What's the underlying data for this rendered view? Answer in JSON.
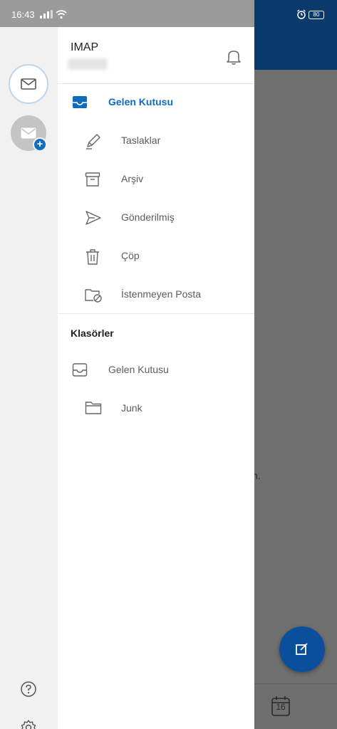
{
  "status_bar": {
    "time": "16:43",
    "battery": "80"
  },
  "account": {
    "title": "IMAP"
  },
  "folders": [
    {
      "label": "Gelen Kutusu",
      "icon": "inbox-icon",
      "active": true
    },
    {
      "label": "Taslaklar",
      "icon": "pencil-icon"
    },
    {
      "label": "Arşiv",
      "icon": "archive-icon"
    },
    {
      "label": "Gönderilmiş",
      "icon": "send-icon"
    },
    {
      "label": "Çöp",
      "icon": "trash-icon"
    },
    {
      "label": "İstenmeyen Posta",
      "icon": "junk-folder-icon"
    }
  ],
  "folders_section": {
    "title": "Klasörler",
    "items": [
      {
        "label": "Gelen Kutusu",
        "icon": "inbox-icon"
      },
      {
        "label": "Junk",
        "icon": "folder-icon"
      }
    ]
  },
  "background": {
    "partial_text": "n.",
    "calendar_day": "16"
  },
  "colors": {
    "accent": "#0f6cbd",
    "header_bg": "#0a3a6b",
    "fab_bg": "#0b4f9c"
  }
}
